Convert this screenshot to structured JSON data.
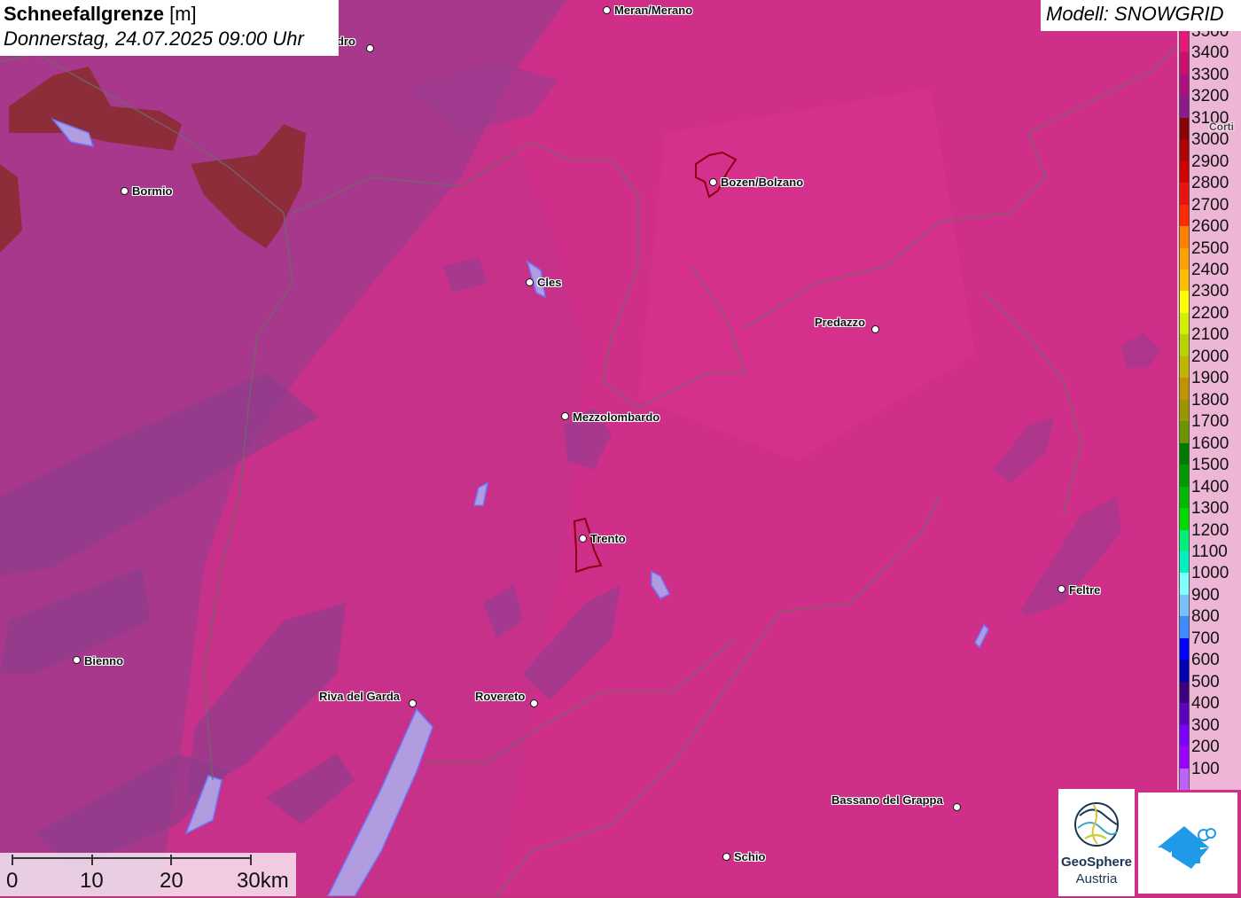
{
  "title": {
    "name": "Schneefallgrenze",
    "unit": "[m]",
    "datetime": "Donnerstag, 24.07.2025 09:00 Uhr"
  },
  "model": "Modell: SNOWGRID",
  "legend": [
    {
      "label": "3500",
      "color": "#e8157a"
    },
    {
      "label": "3400",
      "color": "#cc0f6e"
    },
    {
      "label": "3300",
      "color": "#b00d80"
    },
    {
      "label": "3200",
      "color": "#8c1a8c"
    },
    {
      "label": "3100",
      "color": "#8b0000"
    },
    {
      "label": "3000",
      "color": "#b30000"
    },
    {
      "label": "2900",
      "color": "#d40000"
    },
    {
      "label": "2800",
      "color": "#ee1111"
    },
    {
      "label": "2700",
      "color": "#ff2a00"
    },
    {
      "label": "2600",
      "color": "#ff7f00"
    },
    {
      "label": "2500",
      "color": "#ff9f00"
    },
    {
      "label": "2400",
      "color": "#ffbf00"
    },
    {
      "label": "2300",
      "color": "#ffff00"
    },
    {
      "label": "2200",
      "color": "#d4ee00"
    },
    {
      "label": "2100",
      "color": "#b8d400"
    },
    {
      "label": "2000",
      "color": "#c0b400"
    },
    {
      "label": "1900",
      "color": "#c09400"
    },
    {
      "label": "1800",
      "color": "#9c9400"
    },
    {
      "label": "1700",
      "color": "#6c9400"
    },
    {
      "label": "1600",
      "color": "#007a00"
    },
    {
      "label": "1500",
      "color": "#009a00"
    },
    {
      "label": "1400",
      "color": "#00ba00"
    },
    {
      "label": "1300",
      "color": "#00dc00"
    },
    {
      "label": "1200",
      "color": "#00f07a"
    },
    {
      "label": "1100",
      "color": "#00f0c0"
    },
    {
      "label": "1000",
      "color": "#80ffff"
    },
    {
      "label": "900",
      "color": "#7ac0ff"
    },
    {
      "label": "800",
      "color": "#3c8cff"
    },
    {
      "label": "700",
      "color": "#0000ff"
    },
    {
      "label": "600",
      "color": "#0000b4"
    },
    {
      "label": "500",
      "color": "#3c0080"
    },
    {
      "label": "400",
      "color": "#6000c0"
    },
    {
      "label": "300",
      "color": "#8000ff"
    },
    {
      "label": "200",
      "color": "#9c00ff"
    },
    {
      "label": "100",
      "color": "#c060ff"
    }
  ],
  "cities": [
    {
      "name": "Meran/Merano",
      "side": "right"
    },
    {
      "name": "ndro",
      "side": "left"
    },
    {
      "name": "Bozen/Bolzano",
      "side": "right"
    },
    {
      "name": "Bormio",
      "side": "right"
    },
    {
      "name": "Cles",
      "side": "right"
    },
    {
      "name": "Predazzo",
      "side": "left"
    },
    {
      "name": "Mezzolombardo",
      "side": "right"
    },
    {
      "name": "Trento",
      "side": "right"
    },
    {
      "name": "Feltre",
      "side": "right"
    },
    {
      "name": "Bienno",
      "side": "right"
    },
    {
      "name": "Riva del Garda",
      "side": "left"
    },
    {
      "name": "Rovereto",
      "side": "left"
    },
    {
      "name": "Bassano del Grappa",
      "side": "left"
    },
    {
      "name": "Schio",
      "side": "right"
    },
    {
      "name": "Corti",
      "side": "right"
    }
  ],
  "scalebar": {
    "ticks": [
      "0",
      "10",
      "20",
      "30km"
    ]
  },
  "logos": {
    "geosphere_line1": "GeoSphere",
    "geosphere_line2": "Austria"
  }
}
